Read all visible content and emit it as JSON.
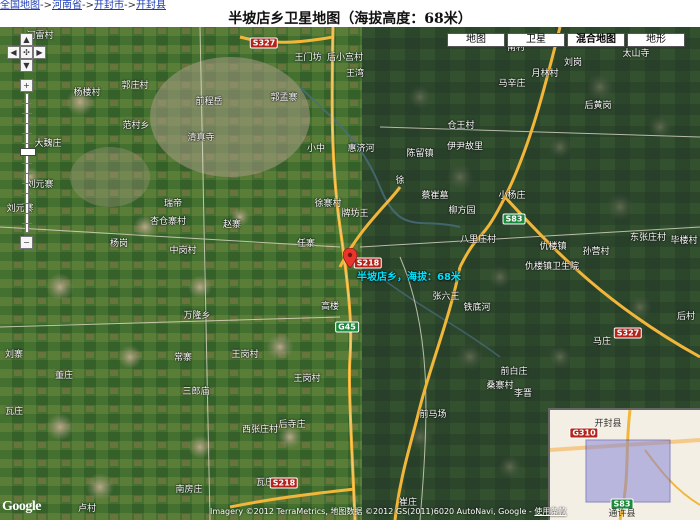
{
  "breadcrumb": {
    "items": [
      "全国地图",
      "河南省",
      "开封市",
      "开封县"
    ],
    "separator": "->"
  },
  "title": "半坡店乡卫星地图（海拔高度：68米）",
  "map_types": {
    "buttons": [
      "地图",
      "卫星",
      "混合地图",
      "地形"
    ],
    "active": "混合地图"
  },
  "zoom_controls": {
    "plus": "+",
    "minus": "−"
  },
  "marker": {
    "label": "半坡店乡，海拔：68米",
    "color": "#e8362c",
    "label_color": "#00e5ff"
  },
  "place_labels": [
    "河雷村",
    "王门坊",
    "后小宫村",
    "王湾",
    "南村",
    "刘岗",
    "太山寺",
    "杨楼村",
    "郭庄村",
    "月林村",
    "郭孟寨",
    "前程岳",
    "马辛庄",
    "后黄岗",
    "范村乡",
    "清真寺",
    "仓王村",
    "大魏庄",
    "小中",
    "惠济河",
    "陈留镇",
    "伊尹故里",
    "刘元寨",
    "瑞帝",
    "徐寨村",
    "蔡崔墓",
    "小杨庄",
    "柳方园",
    "徐",
    "刘元寨",
    "杏仓寨村",
    "赵寨",
    "牌坊王",
    "八里庄村",
    "仇楼镇",
    "东张庄村",
    "毕楼村",
    "杨岗",
    "中岗村",
    "任寨",
    "仇楼镇卫生院",
    "孙营村",
    "万隆乡",
    "高楼",
    "张六王",
    "铁底河",
    "后村",
    "常寨",
    "王岗村",
    "马庄",
    "刘寨",
    "董庄",
    "三郎庙",
    "瓦庄",
    "前白庄",
    "李晋",
    "西张庄村",
    "后寺庄",
    "王岗村",
    "桑寨村",
    "前马场",
    "南房庄",
    "瓦庄",
    "卢村",
    "崔庄",
    "通许县",
    "开封县"
  ],
  "road_shields": [
    "S327",
    "S218",
    "G45",
    "S83",
    "S327",
    "S218",
    "G310",
    "S83"
  ],
  "attribution": {
    "text": "Imagery ©2012 TerraMetrics, 地图数据 ©2012 GS(2011)6020 AutoNavi, Google - ",
    "terms": "使用条款"
  },
  "logo": "Google",
  "overview": {
    "city_label": "开封县",
    "road_shield_1": "G310",
    "road_shield_2": "S83",
    "road_bottom": "通许县"
  },
  "colors": {
    "farmland_left": "#3f6a2e",
    "farmland_right": "#2f4a2f",
    "highway": "#f2b63a",
    "route_shield_red": "#b4241c",
    "route_shield_green": "#1c8a3c"
  }
}
